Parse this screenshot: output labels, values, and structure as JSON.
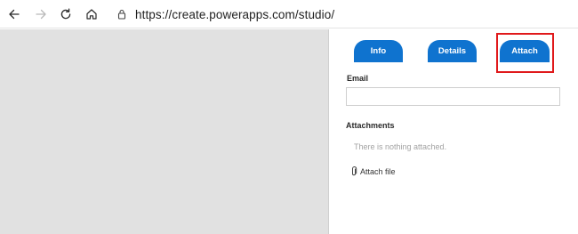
{
  "browser": {
    "url": "https://create.powerapps.com/studio/",
    "icons": [
      "back-icon",
      "forward-icon",
      "refresh-icon",
      "home-icon",
      "lock-icon"
    ]
  },
  "tabs": [
    {
      "label": "Info"
    },
    {
      "label": "Details"
    },
    {
      "label": "Attach",
      "highlighted": true
    }
  ],
  "form": {
    "email_label": "Email",
    "email_value": "",
    "attachments_label": "Attachments",
    "empty_message": "There is nothing attached.",
    "attach_file_label": "Attach file"
  },
  "colors": {
    "tab_bg": "#0f73cf",
    "highlight": "#e0191b",
    "left_pane": "#e1e1e1"
  }
}
